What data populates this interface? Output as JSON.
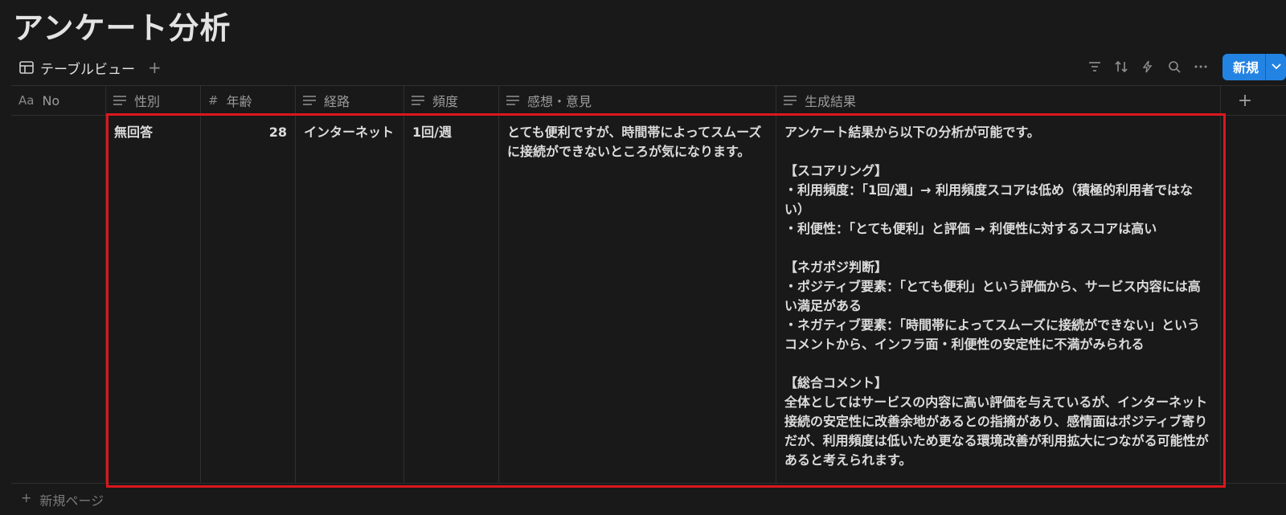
{
  "title": "アンケート分析",
  "view": {
    "tab_label": "テーブルビュー",
    "add": "+"
  },
  "toolbar": {
    "icons": [
      "filter-icon",
      "sort-icon",
      "automation-icon",
      "search-icon",
      "more-icon"
    ],
    "new_label": "新規",
    "accent": "#2383e2"
  },
  "columns": [
    {
      "icon": "Aa",
      "label": "No"
    },
    {
      "icon": "text-icon",
      "label": "性別"
    },
    {
      "icon": "#",
      "label": "年齢"
    },
    {
      "icon": "text-icon",
      "label": "経路"
    },
    {
      "icon": "text-icon",
      "label": "頻度"
    },
    {
      "icon": "text-icon",
      "label": "感想・意見"
    },
    {
      "icon": "text-icon",
      "label": "生成結果"
    },
    {
      "icon": "+",
      "label": ""
    }
  ],
  "row": {
    "no": "",
    "gender": "無回答",
    "age": "28",
    "route": "インターネット",
    "frequency": "1回/週",
    "feedback": "とても便利ですが、時間帯によってスムーズに接続ができないところが気になります。",
    "result": "アンケート結果から以下の分析が可能です。\n\n【スコアリング】\n・利用頻度：「1回/週」→ 利用頻度スコアは低め（積極的利用者ではない）\n・利便性：「とても便利」と評価 → 利便性に対するスコアは高い\n\n【ネガポジ判断】\n・ポジティブ要素：「とても便利」という評価から、サービス内容には高い満足がある\n・ネガティブ要素：「時間帯によってスムーズに接続ができない」というコメントから、インフラ面・利便性の安定性に不満がみられる\n\n【総合コメント】\n全体としてはサービスの内容に高い評価を与えているが、インターネット接続の安定性に改善余地があるとの指摘があり、感情面はポジティブ寄りだが、利用頻度は低いため更なる環境改善が利用拡大につながる可能性があると考えられます。"
  },
  "footer": {
    "plus": "+",
    "new_page": "新規ページ"
  },
  "highlight_color": "#d9181e"
}
